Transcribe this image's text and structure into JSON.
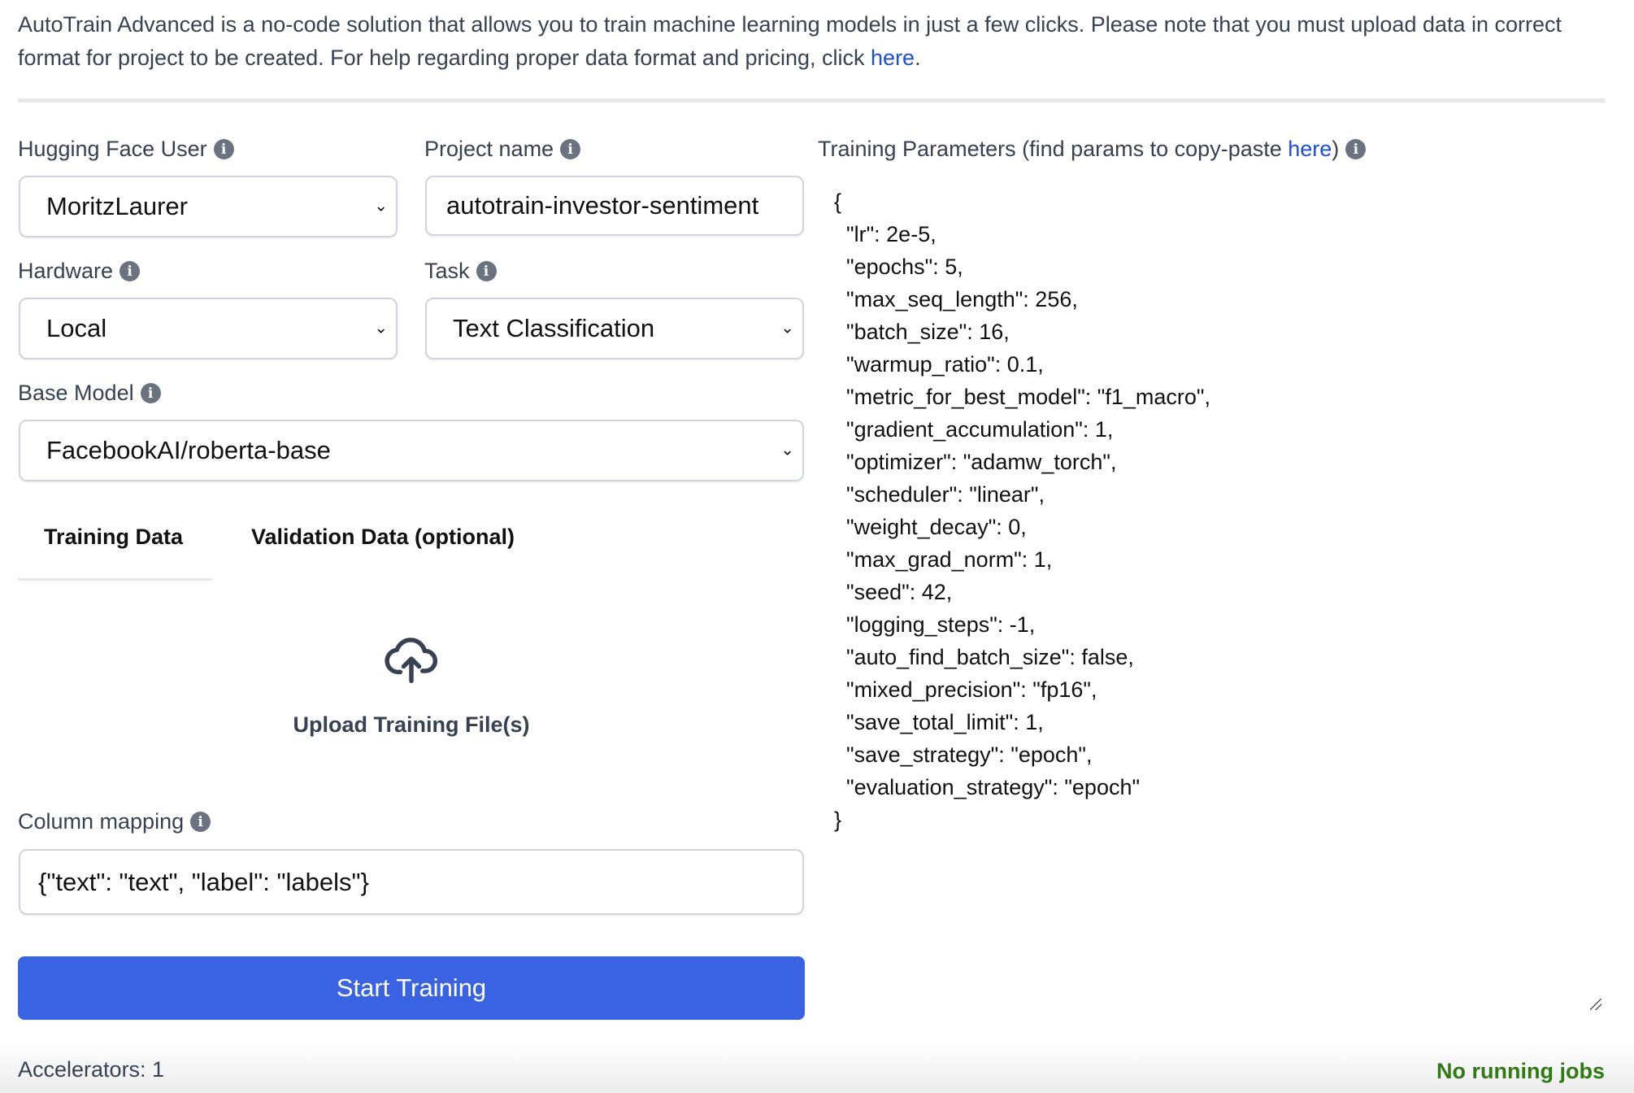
{
  "intro": {
    "text": "AutoTrain Advanced is a no-code solution that allows you to train machine learning models in just a few clicks. Please note that you must upload data in correct format for project to be created. For help regarding proper data format and pricing, click ",
    "link": "here",
    "end": "."
  },
  "fields": {
    "hf_user": {
      "label": "Hugging Face User",
      "value": "MoritzLaurer"
    },
    "project_name": {
      "label": "Project name",
      "value": "autotrain-investor-sentiment"
    },
    "hardware": {
      "label": "Hardware",
      "value": "Local"
    },
    "task": {
      "label": "Task",
      "value": "Text Classification"
    },
    "base_model": {
      "label": "Base Model",
      "value": "FacebookAI/roberta-base"
    },
    "column_mapping": {
      "label": "Column mapping",
      "value": "{\"text\": \"text\", \"label\": \"labels\"}"
    }
  },
  "tabs": [
    {
      "label": "Training Data",
      "active": true
    },
    {
      "label": "Validation Data (optional)",
      "active": false
    }
  ],
  "upload": {
    "label": "Upload Training File(s)",
    "icon": "cloud-upload-icon"
  },
  "params": {
    "label_pre": "Training Parameters (find params to copy-paste ",
    "link": "here",
    "label_post": ")",
    "value": "{\n  \"lr\": 2e-5,\n  \"epochs\": 5,\n  \"max_seq_length\": 256,\n  \"batch_size\": 16,\n  \"warmup_ratio\": 0.1,\n  \"metric_for_best_model\": \"f1_macro\",\n  \"gradient_accumulation\": 1,\n  \"optimizer\": \"adamw_torch\",\n  \"scheduler\": \"linear\",\n  \"weight_decay\": 0,\n  \"max_grad_norm\": 1,\n  \"seed\": 42,\n  \"logging_steps\": -1,\n  \"auto_find_batch_size\": false,\n  \"mixed_precision\": \"fp16\",\n  \"save_total_limit\": 1,\n  \"save_strategy\": \"epoch\",\n  \"evaluation_strategy\": \"epoch\"\n}"
  },
  "start_button": "Start Training",
  "footer": {
    "accelerators": "Accelerators: 1",
    "jobs": "No running jobs"
  },
  "colors": {
    "primary": "#3a63e3",
    "link": "#1d4ed8",
    "jobs": "#2f7a12"
  }
}
